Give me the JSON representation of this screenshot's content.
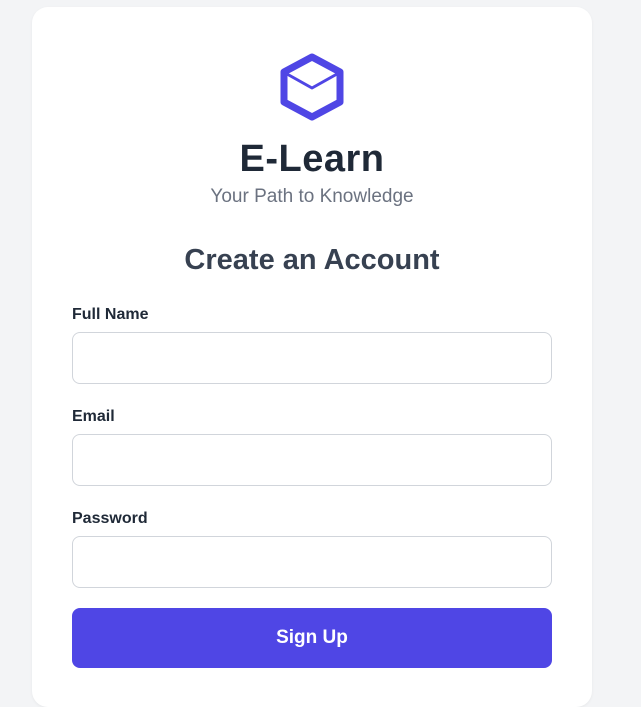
{
  "brand": {
    "name": "E-Learn",
    "tagline": "Your Path to Knowledge",
    "logo_icon": "cube-icon",
    "accent_color": "#4f46e5"
  },
  "form": {
    "heading": "Create an Account",
    "fields": [
      {
        "label": "Full Name",
        "value": "",
        "placeholder": ""
      },
      {
        "label": "Email",
        "value": "",
        "placeholder": ""
      },
      {
        "label": "Password",
        "value": "",
        "placeholder": ""
      }
    ],
    "submit_label": "Sign Up"
  }
}
